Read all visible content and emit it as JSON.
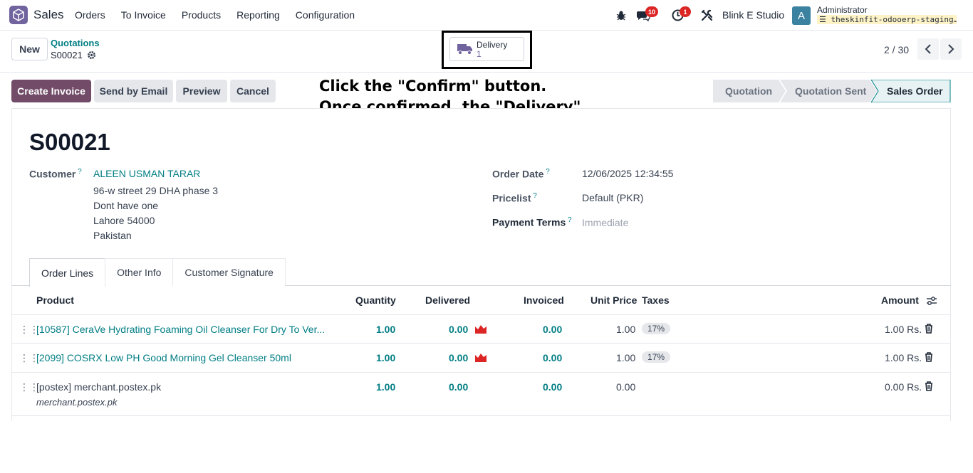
{
  "navbar": {
    "app_name": "Sales",
    "menu": [
      "Orders",
      "To Invoice",
      "Products",
      "Reporting",
      "Configuration"
    ],
    "messages_count": "10",
    "activities_count": "1",
    "company": "Blink E Studio",
    "avatar_letter": "A",
    "user": "Administrator",
    "database": "theskinfit-odooerp-staging…"
  },
  "control_panel": {
    "new_label": "New",
    "breadcrumb_parent": "Quotations",
    "breadcrumb_current": "S00021",
    "smart_button": {
      "label": "Delivery",
      "count": "1"
    },
    "pager": "2 / 30"
  },
  "actions": {
    "create_invoice": "Create Invoice",
    "send_email": "Send by Email",
    "preview": "Preview",
    "cancel": "Cancel"
  },
  "stages": [
    "Quotation",
    "Quotation Sent",
    "Sales Order"
  ],
  "active_stage": "Sales Order",
  "instructions": "Click the \"Confirm\" button. Once confirmed, the \"Delivery\" smart button will appear. Click the smart button to proceed.",
  "order": {
    "name": "S00021",
    "customer_label": "Customer",
    "customer_name": "ALEEN USMAN TARAR",
    "address": [
      "96-w street 29 DHA phase 3",
      "Dont have one",
      "Lahore 54000",
      "Pakistan"
    ],
    "order_date_label": "Order Date",
    "order_date": "12/06/2025 12:34:55",
    "pricelist_label": "Pricelist",
    "pricelist": "Default (PKR)",
    "payment_terms_label": "Payment Terms",
    "payment_terms": "Immediate"
  },
  "tabs": [
    "Order Lines",
    "Other Info",
    "Customer Signature"
  ],
  "table": {
    "headers": {
      "product": "Product",
      "quantity": "Quantity",
      "delivered": "Delivered",
      "invoiced": "Invoiced",
      "unit_price": "Unit Price",
      "taxes": "Taxes",
      "amount": "Amount"
    },
    "rows": [
      {
        "product": "[10587] CeraVe Hydrating Foaming Oil Cleanser For Dry To Ver...",
        "quantity": "1.00",
        "delivered": "0.00",
        "invoiced": "0.00",
        "unit_price": "1.00",
        "tax": "17%",
        "amount": "1.00 Rs."
      },
      {
        "product": "[2099] COSRX Low PH Good Morning Gel Cleanser 50ml",
        "quantity": "1.00",
        "delivered": "0.00",
        "invoiced": "0.00",
        "unit_price": "1.00",
        "tax": "17%",
        "amount": "1.00 Rs."
      },
      {
        "product": "[postex] merchant.postex.pk",
        "description": "merchant.postex.pk",
        "quantity": "1.00",
        "delivered": "0.00",
        "invoiced": "0.00",
        "unit_price": "0.00",
        "tax": "",
        "amount": "0.00 Rs."
      }
    ]
  },
  "colors": {
    "brand": "#714b67",
    "link": "#017e84",
    "badge": "#dc2626"
  }
}
